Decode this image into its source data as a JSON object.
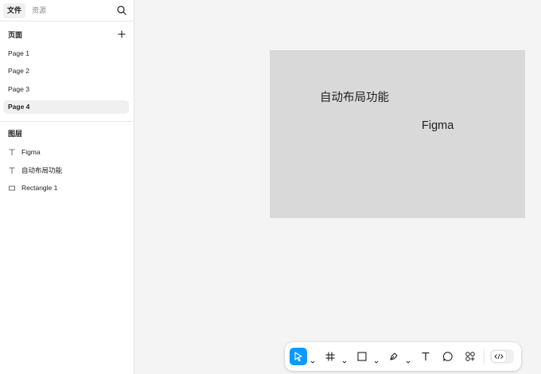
{
  "sidebar": {
    "tabs": [
      {
        "label": "文件",
        "active": true
      },
      {
        "label": "资源",
        "active": false
      }
    ],
    "search_icon": "search-icon",
    "pages_section": {
      "title": "页面",
      "add_icon": "plus-icon"
    },
    "pages": [
      {
        "label": "Page 1",
        "selected": false
      },
      {
        "label": "Page 2",
        "selected": false
      },
      {
        "label": "Page 3",
        "selected": false
      },
      {
        "label": "Page 4",
        "selected": true
      }
    ],
    "layers_section": {
      "title": "图层"
    },
    "layers": [
      {
        "label": "Figma",
        "icon": "text-layer-icon"
      },
      {
        "label": "自动布局功能",
        "icon": "text-layer-icon"
      },
      {
        "label": "Rectangle 1",
        "icon": "rectangle-layer-icon"
      }
    ]
  },
  "canvas": {
    "background": "#f4f4f4",
    "frame": {
      "fill": "#d9d9d9",
      "texts": [
        "自动布局功能",
        "Figma"
      ]
    }
  },
  "toolbar": {
    "tools": [
      {
        "name": "move-tool",
        "icon": "pointer-icon",
        "active": true
      },
      {
        "name": "frame-tool",
        "icon": "hash-frame-icon"
      },
      {
        "name": "rectangle-tool",
        "icon": "square-icon"
      },
      {
        "name": "pen-tool",
        "icon": "pen-icon"
      },
      {
        "name": "text-tool",
        "icon": "text-icon"
      },
      {
        "name": "comment-tool",
        "icon": "comment-icon"
      },
      {
        "name": "resources-tool",
        "icon": "shapes-plus-icon"
      }
    ],
    "dev_mode_icon": "code-icon",
    "accent_color": "#0d99ff"
  }
}
